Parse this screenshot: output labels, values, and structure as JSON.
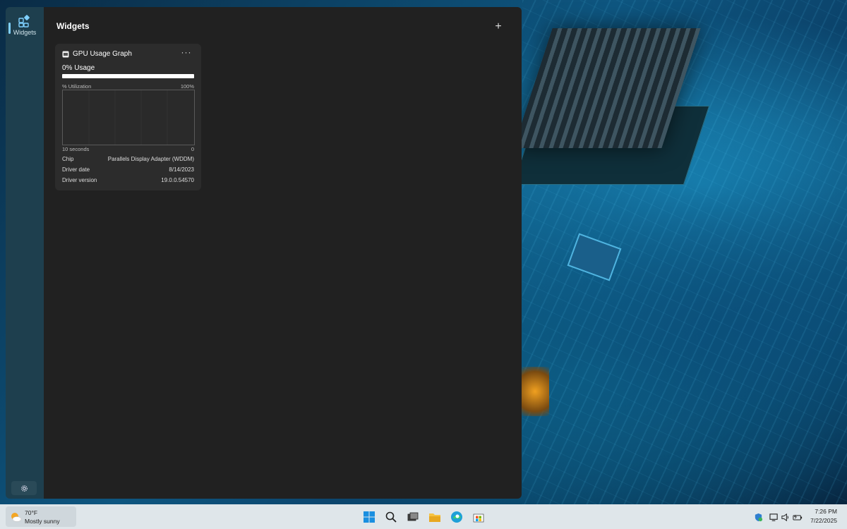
{
  "sidebar": {
    "nav_label": "Widgets"
  },
  "panel": {
    "title": "Widgets",
    "add_label": "+"
  },
  "widget": {
    "title": "GPU Usage Graph",
    "more_label": "···",
    "usage_text": "0% Usage",
    "usage_fraction": 0,
    "graph": {
      "y_label": "% Utilization",
      "y_max": "100%",
      "x_left": "10 seconds",
      "x_right": "0",
      "points": []
    },
    "details": [
      {
        "key": "Chip",
        "value": "Parallels Display Adapter (WDDM)"
      },
      {
        "key": "Driver date",
        "value": "8/14/2023"
      },
      {
        "key": "Driver version",
        "value": "19.0.0.54570"
      }
    ]
  },
  "taskbar": {
    "weather": {
      "temp": "70°F",
      "condition": "Mostly sunny"
    },
    "apps": [
      "start-icon",
      "search-icon",
      "task-view-icon",
      "file-explorer-icon",
      "edge-icon",
      "store-icon"
    ],
    "tray": [
      "security-icon",
      "network-icon",
      "volume-icon",
      "battery-icon"
    ],
    "clock": {
      "time": "7:26 PM",
      "date": "7/22/2025"
    }
  },
  "colors": {
    "panel_bg": "#212121",
    "card_bg": "#2c2c2c",
    "sidebar_bg": "#1e3f4e",
    "taskbar_bg": "#dfe6ea"
  }
}
